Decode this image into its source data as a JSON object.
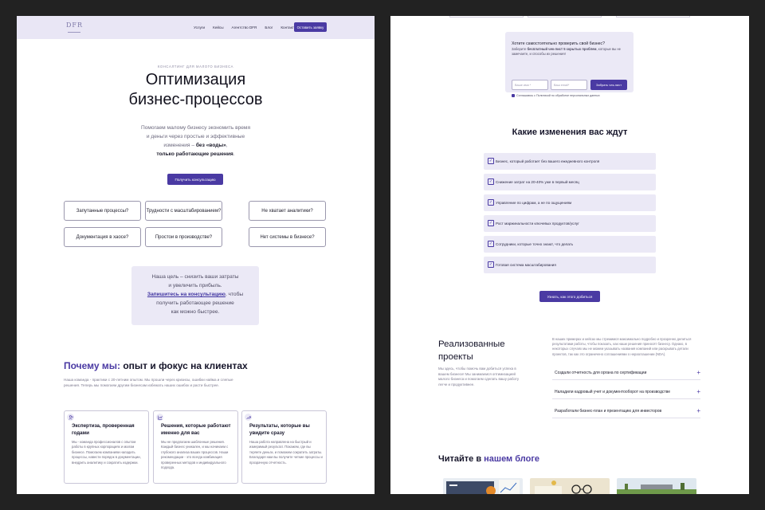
{
  "left_page": {
    "nav": {
      "logo": "DFR",
      "links": [
        "Услуги",
        "Кейсы",
        "Агентство DFR",
        "Блог",
        "Контакты"
      ],
      "cta": "Оставить заявку"
    },
    "hero": {
      "eyebrow": "КОНСАЛТИНГ ДЛЯ МАЛОГО БИЗНЕСА",
      "title_line1": "Оптимизация",
      "title_line2": "бизнес-процессов",
      "subtitle_line1": "Помогаем малому бизнесу экономить время",
      "subtitle_line2": "и деньги через простые и эффективные",
      "subtitle_line3_pre": "изменения – ",
      "subtitle_line3_bold": "без «воды»",
      "subtitle_line3_post": ",",
      "subtitle_line4": "только работающие решения",
      "subtitle_line4_post": ".",
      "button": "Получить консультацию"
    },
    "problems": [
      "Запутанные процессы?",
      "Трудности с масштабированием?",
      "Не хватает аналитики?",
      "Документация в хаосе?",
      "Простои в производстве?",
      "Нет системы в бизнесе?"
    ],
    "goal": {
      "line1": "Наша цель – снизить ваши затраты",
      "line2": "и увеличить прибыль.",
      "line3_link": "Запишитесь на консультацию",
      "line3_post": ", чтобы",
      "line4": "получить работающее решение",
      "line5": "как можно быстрее."
    },
    "why": {
      "title_accent": "Почему мы:",
      "title_rest": " опыт и фокус на клиентах",
      "text": "Наша команда - практики с 20-летним опытом. Мы прошли через кризисы, ошибки найма и слепые решения. Теперь мы помогаем другим бизнесам избежать наших ошибок и расти быстрее."
    },
    "cards": [
      {
        "icon": "people-icon",
        "title": "Экспертиза, проверенная годами",
        "text": "Мы - команда профессионалов с опытом работы в крупных корпорациях и малом бизнесе. Помогаем компаниям наладить процессы, навести порядок в документации, внедрить аналитику и сократить издержки."
      },
      {
        "icon": "chart-icon",
        "title": "Решения, которые работают именно для вас",
        "text": "Мы не предлагаем шаблонные решения. Каждый бизнес уникален, и мы начинаем с глубокого анализа ваших процессов. Наши рекомендации - это всегда комбинация проверенных методов и индивидуального подхода."
      },
      {
        "icon": "growth-icon",
        "title": "Результаты, которые вы увидите сразу",
        "text": "Наша работа направлена на быстрый и измеримый результат. Покажем, где вы теряете деньги, и поможем сократить затраты. Благодаря нам вы получите четкие процессы и прозрачную отчетность."
      }
    ]
  },
  "right_page": {
    "check": {
      "title": "Хотите самостоятельно проверить свой бизнес?",
      "text_pre": "Заберите ",
      "text_bold": "бесплатный чек-лист 5 скрытых проблем",
      "text_post": ", которые вы не замечаете, и способы их решения!",
      "name_placeholder": "Ваше имя *",
      "email_placeholder": "Ваш email*",
      "button": "Забрать чек-лист",
      "consent": "Соглашаюсь с Политикой по обработке персональных данных"
    },
    "changes": {
      "title": "Какие изменения вас ждут",
      "items": [
        "Бизнес, который работает без вашего ежедневного контроля",
        "Снижение затрат на 20-40% уже в первый месяц",
        "Управление по цифрам, а не по ощущениям",
        "Рост маржинальности ключевых продуктов/услуг",
        "Сотрудники, которые точно знают, что делать",
        "Готовая система масштабирования"
      ],
      "button": "Узнать, как этого добиться"
    },
    "projects": {
      "title_line1": "Реализованные",
      "title_line2": "проекты",
      "text": "Мы здесь, чтобы помочь вам добиться успеха в вашем бизнесе! Мы занимаемся оптимизацией малого бизнеса и помогаем сделать вашу работу легче и продуктивнее.",
      "intro": "В наших примерах и кейсах мы стремимся максимально подробно и прозрачно делиться результатами работы, чтобы показать, как наши решения приносят бизнесу. Однако, в некоторых случаях мы не можем указывать названия компаний или раскрывать детали проектов, так как это ограничено соглашениями о неразглашении (NDA).",
      "items": [
        "Создали отчетность для органа по сертификации",
        "Наладили кадровый учет и документооборот на производстве",
        "Разработали бизнес-план и презентацию для инвесторов"
      ]
    },
    "blog": {
      "title_pre": "Читайте в ",
      "title_accent": "нашем блоге"
    }
  }
}
